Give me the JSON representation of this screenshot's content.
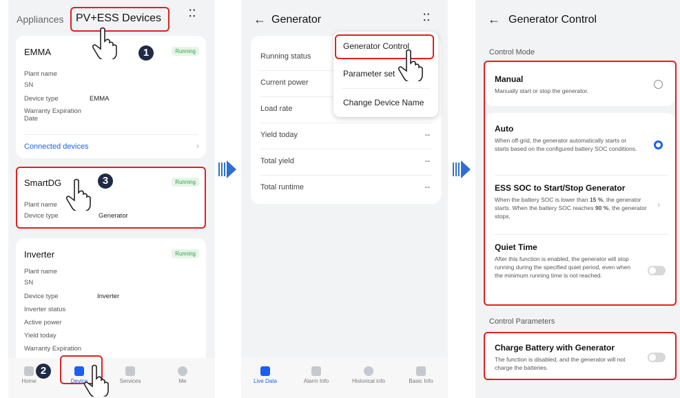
{
  "panel1": {
    "tabs": {
      "appliances": "Appliances",
      "pv_ess": "PV+ESS Devices"
    },
    "emma": {
      "name": "EMMA",
      "status": "Running",
      "rows": [
        {
          "label": "Plant name",
          "value": ""
        },
        {
          "label": "SN",
          "value": ""
        },
        {
          "label": "Device type",
          "value": "EMMA"
        },
        {
          "label": "Warranty Expiration Date",
          "value": ""
        }
      ],
      "connected": "Connected devices"
    },
    "smartdg": {
      "name": "SmartDG",
      "status": "Running",
      "plant_label": "Plant name",
      "type_label": "Device type",
      "type_value": "Generator"
    },
    "inverter": {
      "name": "Inverter",
      "status": "Running",
      "rows": [
        {
          "label": "Plant name",
          "value": ""
        },
        {
          "label": "SN",
          "value": ""
        },
        {
          "label": "Device type",
          "value": "Inverter"
        },
        {
          "label": "Inverter status",
          "value": ""
        },
        {
          "label": "Active power",
          "value": ""
        },
        {
          "label": "Yield today",
          "value": ""
        },
        {
          "label": "Warranty Expiration",
          "value": ""
        }
      ]
    },
    "nav": [
      "Home",
      "Device",
      "Services",
      "Me"
    ],
    "steps": [
      "1",
      "2",
      "3"
    ]
  },
  "panel2": {
    "title": "Generator",
    "rows": [
      {
        "label": "Running status",
        "value": ""
      },
      {
        "label": "Current power",
        "value": ""
      },
      {
        "label": "Load rate",
        "value": ""
      },
      {
        "label": "Yield today",
        "value": "--"
      },
      {
        "label": "Total yield",
        "value": "--"
      },
      {
        "label": "Total runtime",
        "value": "--"
      }
    ],
    "menu": [
      "Generator Control",
      "Parameter set",
      "Change Device Name"
    ],
    "nav": [
      "Live Data",
      "Alarm Info",
      "Historical info",
      "Basic Info"
    ]
  },
  "panel3": {
    "title": "Generator Control",
    "section_mode": "Control Mode",
    "manual": {
      "title": "Manual",
      "desc": "Manually start or stop the generator."
    },
    "auto": {
      "title": "Auto",
      "desc": "When off-grid, the generator automatically starts or starts based on the configured battery SOC conditions."
    },
    "ess": {
      "title": "ESS SOC to Start/Stop Generator",
      "desc_a": "When the battery SOC is lower than ",
      "v1": "15 %",
      "desc_b": ", the generator starts. When the battery SOC reaches ",
      "v2": "90 %",
      "desc_c": ", the generator stops."
    },
    "quiet": {
      "title": "Quiet Time",
      "desc": "After this function is enabled, the generator will stop running during the specified quiet period, even when the minimum running time is not reached."
    },
    "section_params": "Control Parameters",
    "charge": {
      "title": "Charge Battery with Generator",
      "desc": "The function is disabled, and the generator will not charge the batteries."
    }
  },
  "colors": {
    "accent": "#1a5ff2",
    "highlight": "#e02020",
    "running": "#2ea44f"
  }
}
